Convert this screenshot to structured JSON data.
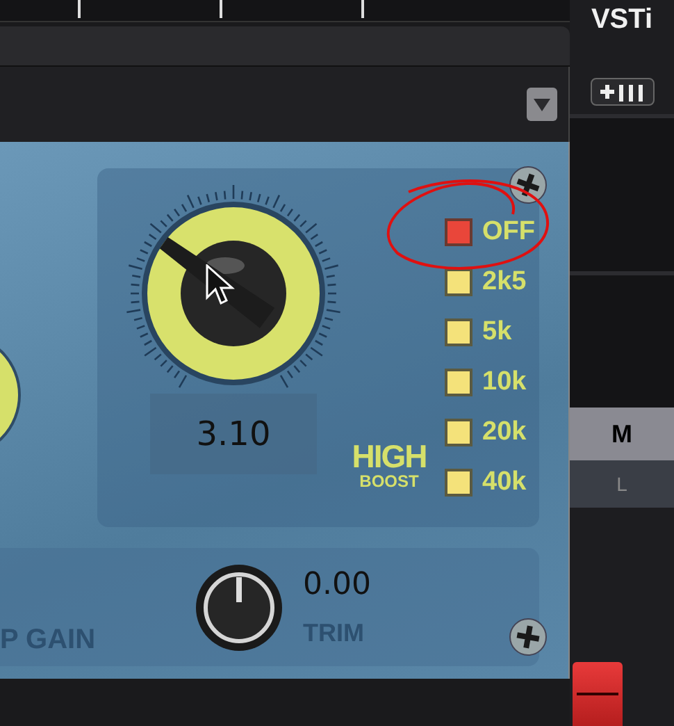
{
  "host": {
    "title": "VSTi",
    "mute_button": "M",
    "lane_button": "L"
  },
  "plugin": {
    "side_gain": {
      "label": "P GAIN"
    },
    "high_boost": {
      "value": "3.10",
      "level": 0.32,
      "label": "HIGH",
      "sublabel": "BOOST",
      "frequencies": [
        {
          "label": "OFF",
          "selected": true
        },
        {
          "label": "2k5",
          "selected": false
        },
        {
          "label": "5k",
          "selected": false
        },
        {
          "label": "10k",
          "selected": false
        },
        {
          "label": "20k",
          "selected": false
        },
        {
          "label": "40k",
          "selected": false
        }
      ]
    },
    "trim": {
      "value": "0.00",
      "label": "TRIM",
      "level": 0.5
    }
  }
}
